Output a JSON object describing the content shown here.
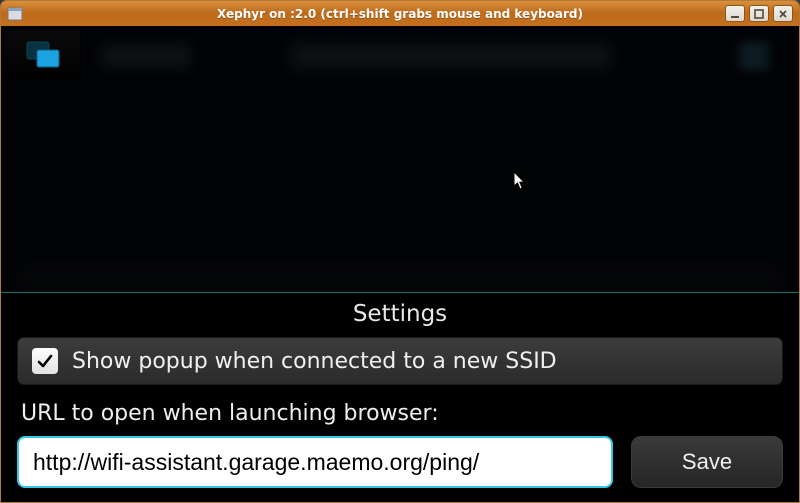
{
  "window": {
    "title": "Xephyr on :2.0 (ctrl+shift grabs mouse and keyboard)"
  },
  "panel": {
    "title": "Settings",
    "show_popup_label": "Show popup when connected to a new SSID",
    "show_popup_checked": true,
    "url_label": "URL to open when launching browser:",
    "url_value": "http://wifi-assistant.garage.maemo.org/ping/",
    "save_label": "Save"
  },
  "colors": {
    "accent": "#34c6e6",
    "titlebar": "#c5701f"
  }
}
